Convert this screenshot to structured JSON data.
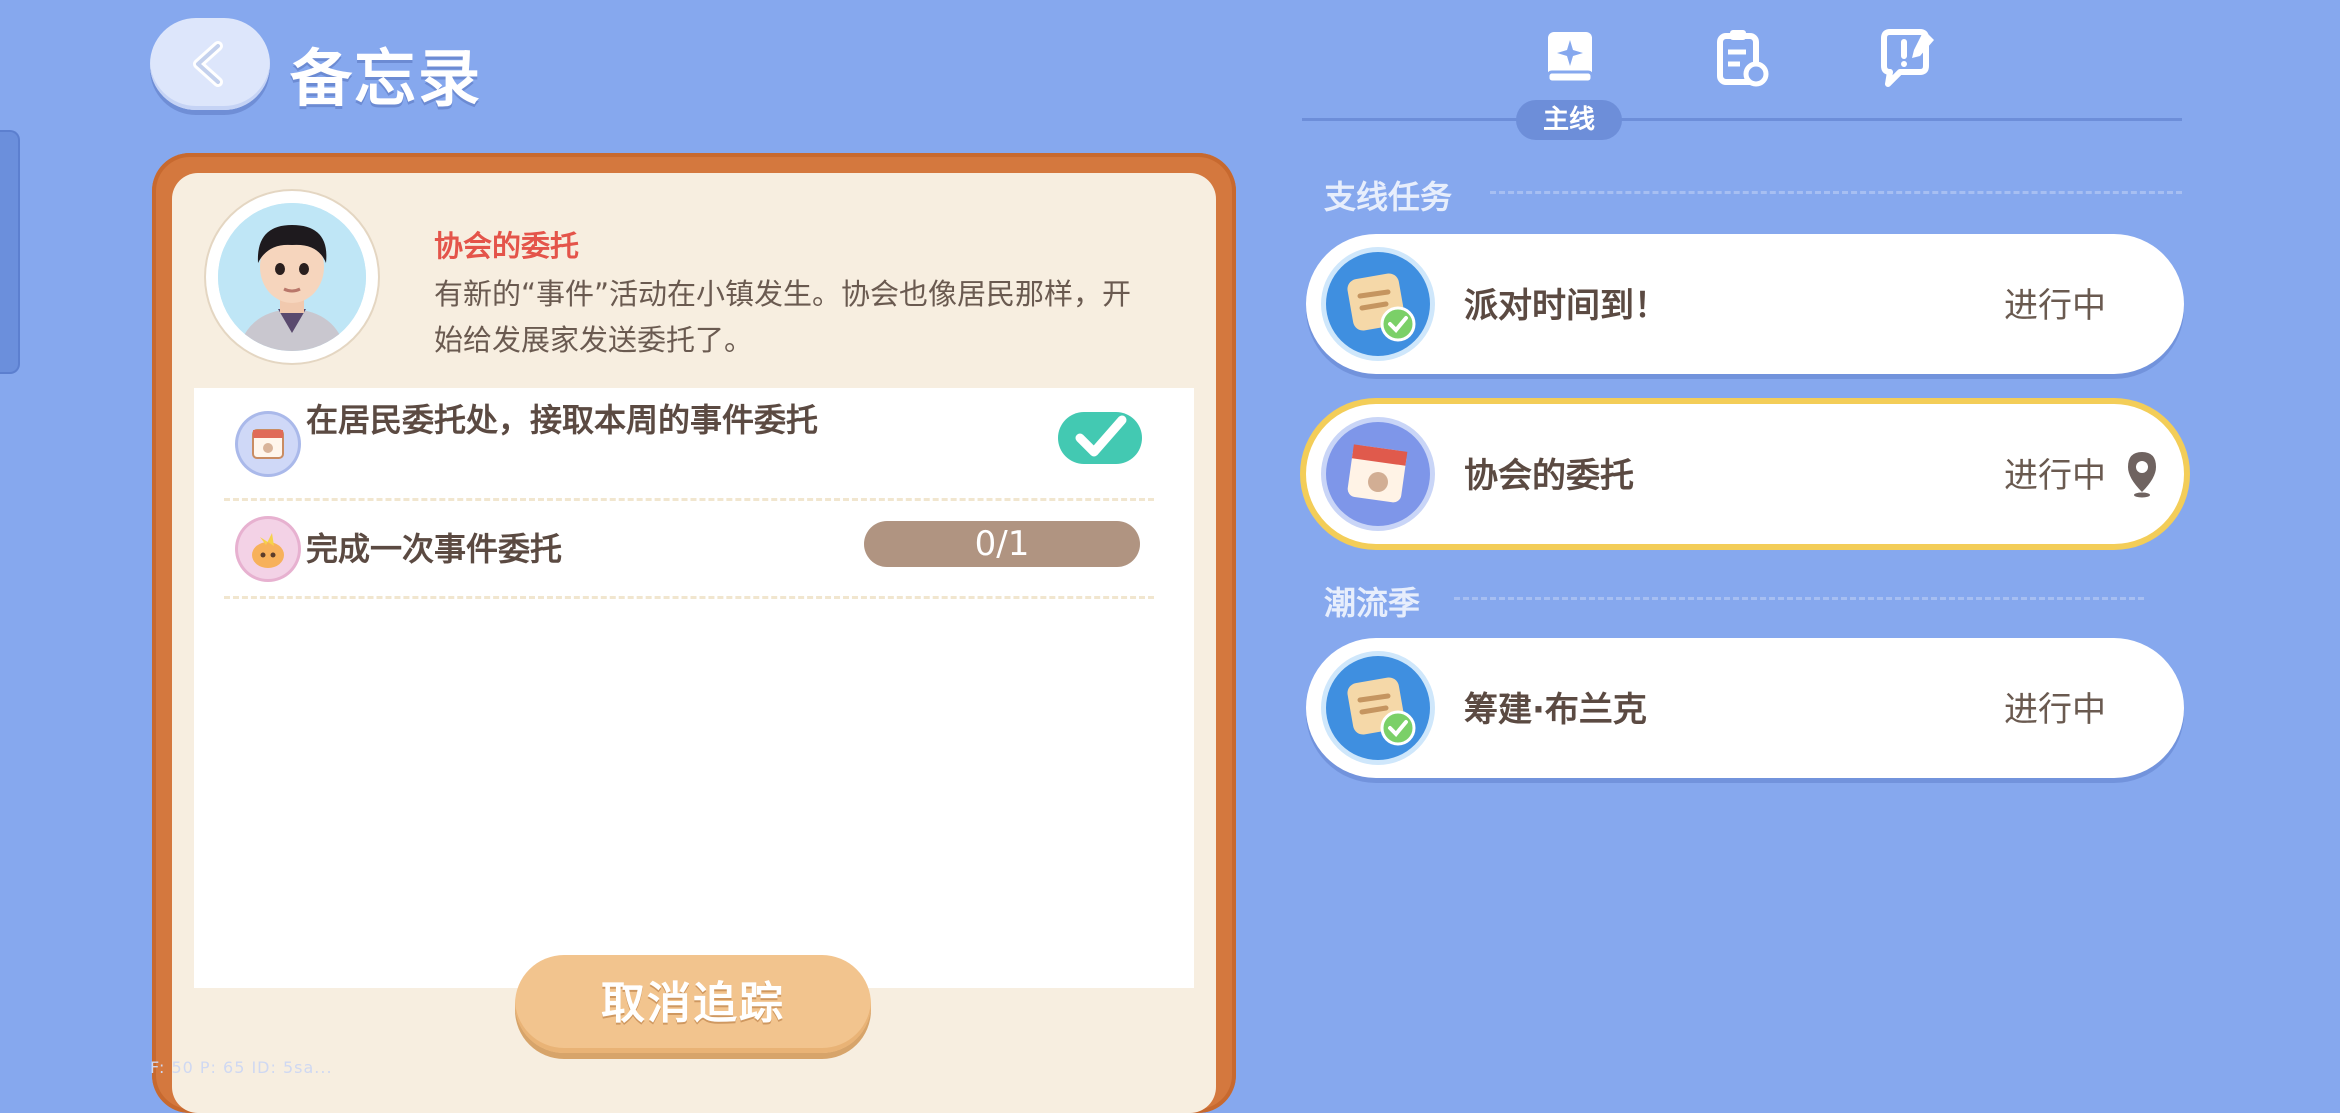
{
  "header": {
    "title": "备忘录"
  },
  "npc": {
    "name": "协会的委托",
    "description": "有新的“事件”活动在小镇发生。协会也像居民那样，开始给发展家发送委托了。"
  },
  "tasks": [
    {
      "text": "在居民委托处，接取本周的事件委托",
      "done": true
    },
    {
      "text": "完成一次事件委托",
      "progress": "0/1"
    }
  ],
  "cancel_label": "取消追踪",
  "debug_text": "F: 50    P: 65    ID: 5sa...",
  "tabs": {
    "active_label": "主线"
  },
  "sections": [
    {
      "title": "支线任务",
      "quests": [
        {
          "name": "派对时间到！",
          "status": "进行中"
        },
        {
          "name": "协会的委托",
          "status": "进行中",
          "tracked": true
        }
      ]
    },
    {
      "title": "潮流季",
      "quests": [
        {
          "name": "筹建·布兰克",
          "status": "进行中"
        }
      ]
    }
  ],
  "colors": {
    "background": "#86a8ee",
    "frame": "#d4783e",
    "accent_red": "#e4544a",
    "check": "#43c9b2",
    "highlight": "#f3cd58"
  }
}
